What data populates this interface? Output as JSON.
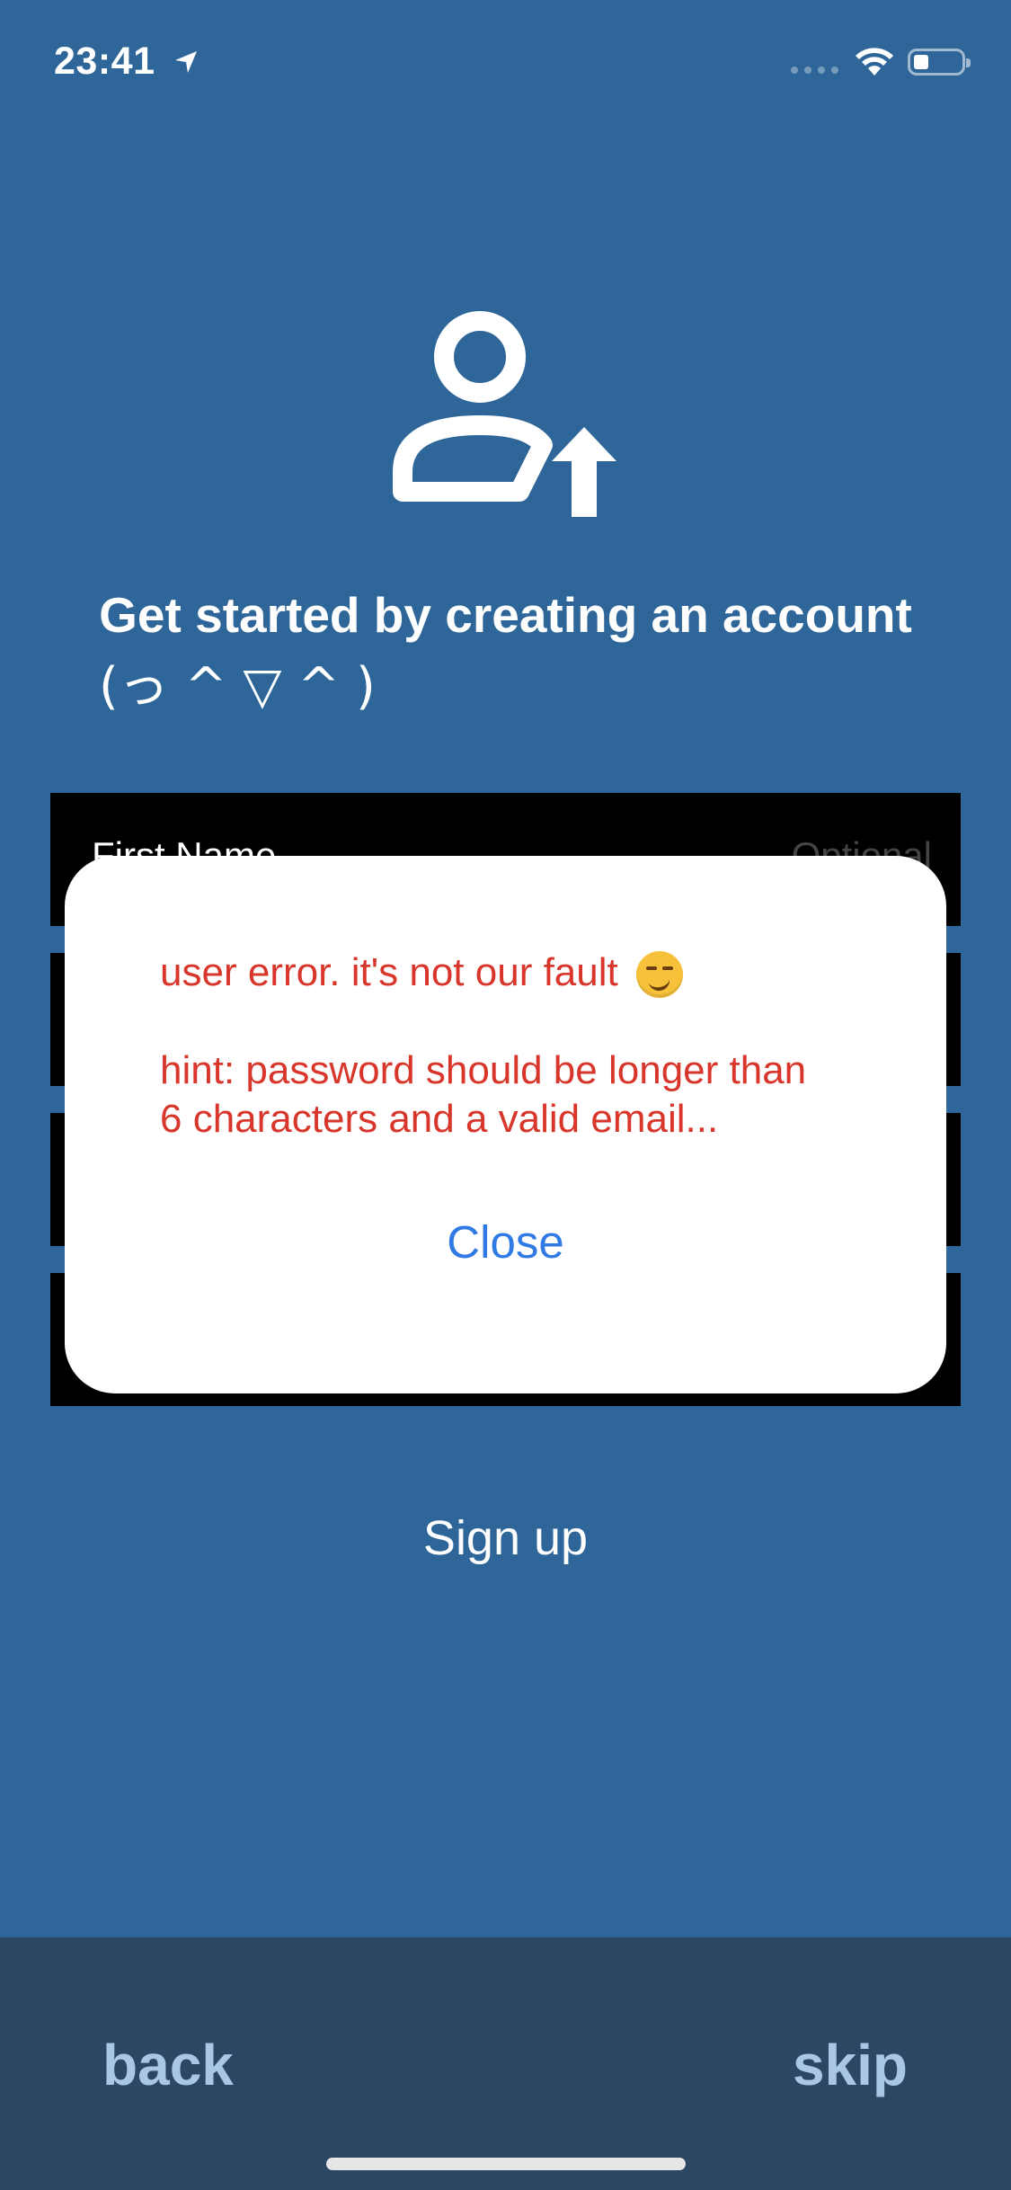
{
  "status_bar": {
    "time": "23:41"
  },
  "onboarding": {
    "headline": "Get started by creating an account",
    "kaomoji": "(っ ^ ▽ ^ )"
  },
  "form": {
    "first_name": {
      "label": "First Name",
      "hint": "Optional"
    }
  },
  "dialog": {
    "error_line": "user error. it's not our fault",
    "hint_line_1": "hint: password should be longer than",
    "hint_line_2": "6 characters and a valid email...",
    "close_label": "Close"
  },
  "actions": {
    "signup_label": "Sign up"
  },
  "bottom_nav": {
    "back_label": "back",
    "skip_label": "skip"
  },
  "colors": {
    "background": "#2e6699",
    "bottom_bar": "#2b4763",
    "error_text": "#d9362b",
    "link": "#2f7ae5"
  },
  "icons": [
    "location-arrow-icon",
    "signal-icon",
    "wifi-icon",
    "battery-icon",
    "add-user-icon",
    "smirk-emoji-icon"
  ]
}
